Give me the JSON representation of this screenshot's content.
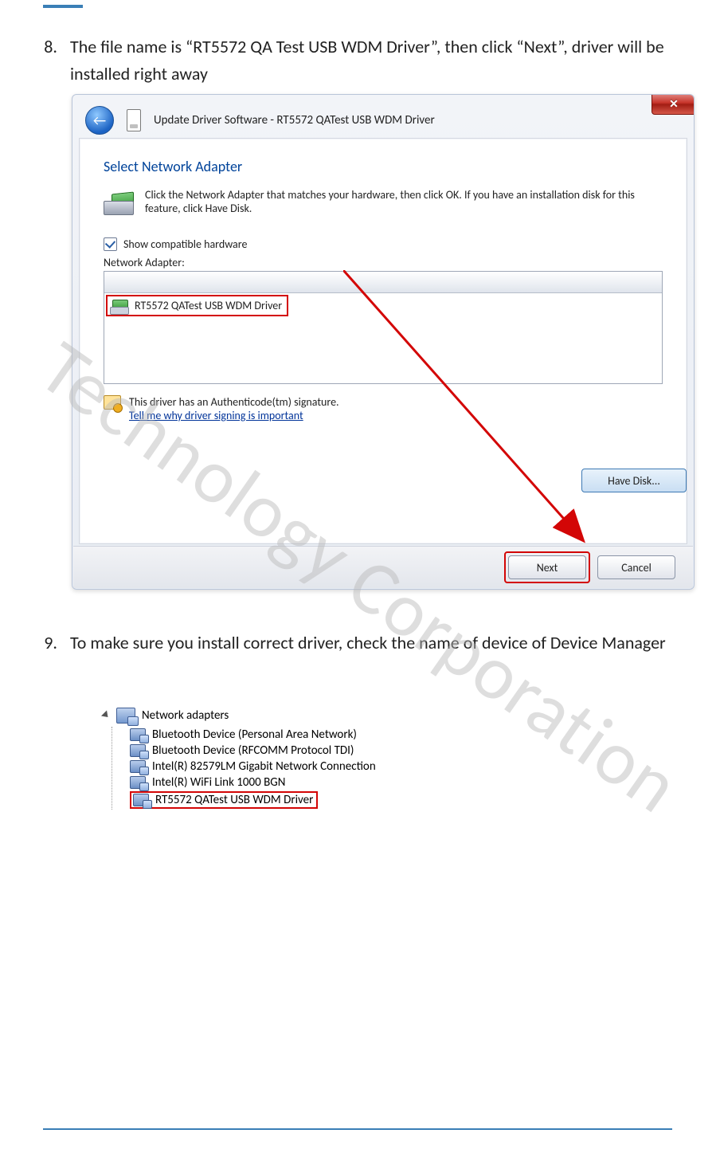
{
  "watermark": "Technology Corporation",
  "step8": {
    "num": "8.",
    "text": "The file name is “RT5572 QA Test USB WDM Driver”, then click “Next”, driver will be installed right away"
  },
  "step9": {
    "num": "9.",
    "text": "To make sure you install correct driver, check the name of device of Device Manager"
  },
  "dialog": {
    "title": "Update Driver Software - RT5572 QATest USB WDM Driver",
    "heading": "Select Network Adapter",
    "instruction": "Click the Network Adapter that matches your hardware, then click OK. If you have an installation disk for this feature, click Have Disk.",
    "showCompatible": "Show compatible hardware",
    "listLabel": "Network Adapter:",
    "listItem": "RT5572 QATest USB WDM Driver",
    "signLine": "This driver has an Authenticode(tm) signature.",
    "helpLink": "Tell me why driver signing is important",
    "haveDisk": "Have Disk...",
    "next": "Next",
    "cancel": "Cancel"
  },
  "dm": {
    "root": "Network adapters",
    "items": [
      "Bluetooth Device (Personal Area Network)",
      "Bluetooth Device (RFCOMM Protocol TDI)",
      "Intel(R) 82579LM Gigabit Network Connection",
      "Intel(R) WiFi Link 1000 BGN",
      "RT5572 QATest USB WDM Driver"
    ],
    "highlightIndex": 4
  }
}
